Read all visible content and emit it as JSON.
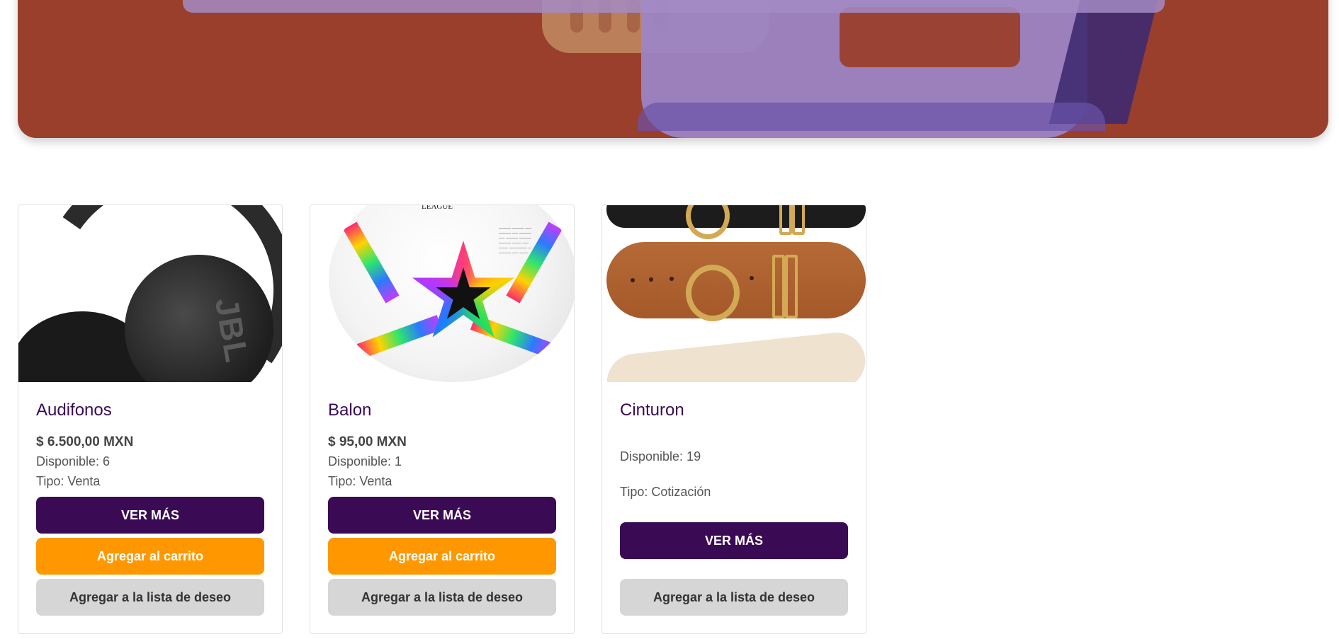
{
  "hero": {
    "accent_color": "#9a3f2c",
    "overlay_color": "#9b86c9"
  },
  "colors": {
    "primary": "#3a0a55",
    "cart": "#ff9800",
    "wishlist": "#d6d6d6"
  },
  "products": [
    {
      "name": "Audifonos",
      "price": "$ 6.500,00 MXN",
      "available": "Disponible: 6",
      "type": "Tipo: Venta",
      "image_icon": "headphones-image",
      "view_label": "VER MÁS",
      "cart_label": "Agregar al carrito",
      "wish_label": "Agregar a la lista de deseo"
    },
    {
      "name": "Balon",
      "price": "$ 95,00 MXN",
      "available": "Disponible: 1",
      "type": "Tipo: Venta",
      "image_icon": "soccer-ball-image",
      "image_text": "UEFA CHAMPIONS LEAGUE",
      "view_label": "VER MÁS",
      "cart_label": "Agregar al carrito",
      "wish_label": "Agregar a la lista de deseo"
    },
    {
      "name": "Cinturon",
      "available": "Disponible: 19",
      "type": "Tipo: Cotización",
      "image_icon": "belts-image",
      "view_label": "VER MÁS",
      "wish_label": "Agregar a la lista de deseo"
    }
  ]
}
